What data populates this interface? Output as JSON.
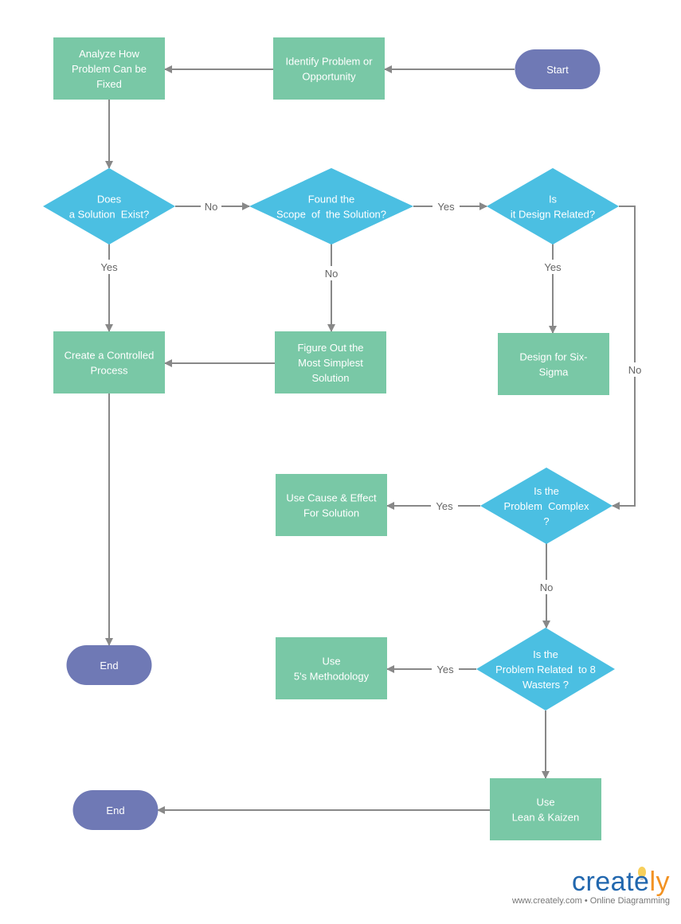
{
  "colors": {
    "process": "#79c8a6",
    "decision": "#4bbfe2",
    "terminal": "#6f79b5",
    "connector": "#888888"
  },
  "nodes": {
    "start": {
      "shape": "terminal",
      "lines": [
        "Start"
      ]
    },
    "identify": {
      "shape": "process",
      "lines": [
        "Identify Problem or",
        "Opportunity"
      ]
    },
    "analyze": {
      "shape": "process",
      "lines": [
        "Analyze How",
        "Problem Can be",
        "Fixed"
      ]
    },
    "solution_exist": {
      "shape": "decision",
      "lines": [
        "Does",
        "a Solution  Exist?"
      ]
    },
    "found_scope": {
      "shape": "decision",
      "lines": [
        "Found the",
        "Scope  of  the Solution?"
      ]
    },
    "design_related": {
      "shape": "decision",
      "lines": [
        "Is",
        "it Design Related?"
      ]
    },
    "controlled": {
      "shape": "process",
      "lines": [
        "Create a Controlled",
        "Process"
      ]
    },
    "figure_out": {
      "shape": "process",
      "lines": [
        "Figure Out the",
        "Most Simplest",
        "Solution"
      ]
    },
    "six_sigma": {
      "shape": "process",
      "lines": [
        "Design for Six-",
        "Sigma"
      ]
    },
    "complex": {
      "shape": "decision",
      "lines": [
        "Is the",
        "Problem  Complex",
        "?"
      ]
    },
    "cause_effect": {
      "shape": "process",
      "lines": [
        "Use Cause & Effect",
        "For Solution"
      ]
    },
    "wasters": {
      "shape": "decision",
      "lines": [
        "Is the",
        "Problem Related  to 8",
        "Wasters ?"
      ]
    },
    "five_s": {
      "shape": "process",
      "lines": [
        "Use",
        "5's Methodology"
      ]
    },
    "lean": {
      "shape": "process",
      "lines": [
        "Use",
        "Lean & Kaizen"
      ]
    },
    "end1": {
      "shape": "terminal",
      "lines": [
        "End"
      ]
    },
    "end2": {
      "shape": "terminal",
      "lines": [
        "End"
      ]
    }
  },
  "edges": [
    {
      "from": "start",
      "to": "identify",
      "label": ""
    },
    {
      "from": "identify",
      "to": "analyze",
      "label": ""
    },
    {
      "from": "analyze",
      "to": "solution_exist",
      "label": ""
    },
    {
      "from": "solution_exist",
      "to": "found_scope",
      "label": "No"
    },
    {
      "from": "found_scope",
      "to": "design_related",
      "label": "Yes"
    },
    {
      "from": "solution_exist",
      "to": "controlled",
      "label": "Yes"
    },
    {
      "from": "found_scope",
      "to": "figure_out",
      "label": "No"
    },
    {
      "from": "design_related",
      "to": "six_sigma",
      "label": "Yes"
    },
    {
      "from": "figure_out",
      "to": "controlled",
      "label": ""
    },
    {
      "from": "design_related",
      "to": "complex",
      "label": "No"
    },
    {
      "from": "complex",
      "to": "cause_effect",
      "label": "Yes"
    },
    {
      "from": "complex",
      "to": "wasters",
      "label": "No"
    },
    {
      "from": "wasters",
      "to": "five_s",
      "label": "Yes"
    },
    {
      "from": "wasters",
      "to": "lean",
      "label": ""
    },
    {
      "from": "lean",
      "to": "end2",
      "label": ""
    },
    {
      "from": "controlled",
      "to": "end1",
      "label": ""
    }
  ],
  "logo": {
    "brand_main": "create",
    "brand_accent": "ly",
    "tagline": "www.creately.com • Online Diagramming"
  }
}
